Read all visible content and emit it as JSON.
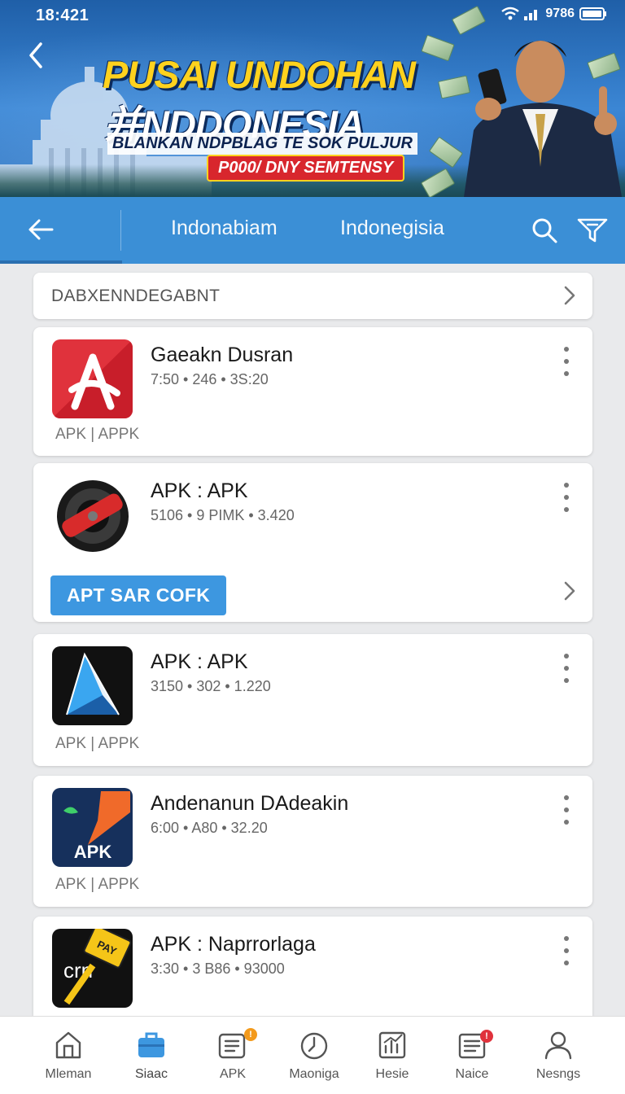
{
  "status_bar": {
    "time": "18:421",
    "battery": "9786"
  },
  "banner": {
    "headline_1": "PUSAI UNDOHAN",
    "headline_2": "并NDDONESIA",
    "headline_3": "BLANKAN NDPBLAG TE SOK PULJUR",
    "cta": "P000/ DNY SEMTENSY"
  },
  "app_bar": {
    "tabs": [
      {
        "label": "Indonabiam"
      },
      {
        "label": "Indonegisia"
      }
    ]
  },
  "section_header": {
    "title": "DABXENNDEGABNT"
  },
  "apps": [
    {
      "name": "Gaeakn Dusran",
      "meta": "7:50 • 246 • 3S:20",
      "tag": "APK  |  APPK",
      "icon": "letter-a-icon",
      "color": "#e0323c"
    },
    {
      "name": "APK : APK",
      "meta": "5106 • 9 PIMK • 3.420",
      "action_label": "APT SAR COFK",
      "icon": "speaker-icon",
      "color": "#d82b2b"
    },
    {
      "name": "APK : APK",
      "meta": "3150 • 302 • 1.220",
      "tag": "APK  |  APPK",
      "icon": "arrow-cursor-icon",
      "color": "#2f8fd8"
    },
    {
      "name": "Andenanun DAdeakin",
      "meta": "6:00 • A80 • 32.20",
      "tag": "APK  |  APPK",
      "icon_text": "APK",
      "icon": "apk-bolt-icon",
      "color": "#f06a2a"
    },
    {
      "name": "APK : Naprrorlaga",
      "meta": "3:30 • 3 B86 • 93000",
      "icon_text": "crn",
      "icon_sign": "PAY",
      "icon": "hammer-sign-icon",
      "color": "#f5c518"
    }
  ],
  "bottom_nav": {
    "items": [
      {
        "label": "Mleman",
        "icon": "home-icon"
      },
      {
        "label": "Siaac",
        "icon": "briefcase-icon"
      },
      {
        "label": "APK",
        "icon": "list-icon",
        "badge": "!"
      },
      {
        "label": "Maoniga",
        "icon": "clock-icon"
      },
      {
        "label": "Hesie",
        "icon": "chart-icon"
      },
      {
        "label": "Naice",
        "icon": "news-icon",
        "badge": "!"
      },
      {
        "label": "Nesngs",
        "icon": "profile-icon"
      }
    ]
  }
}
